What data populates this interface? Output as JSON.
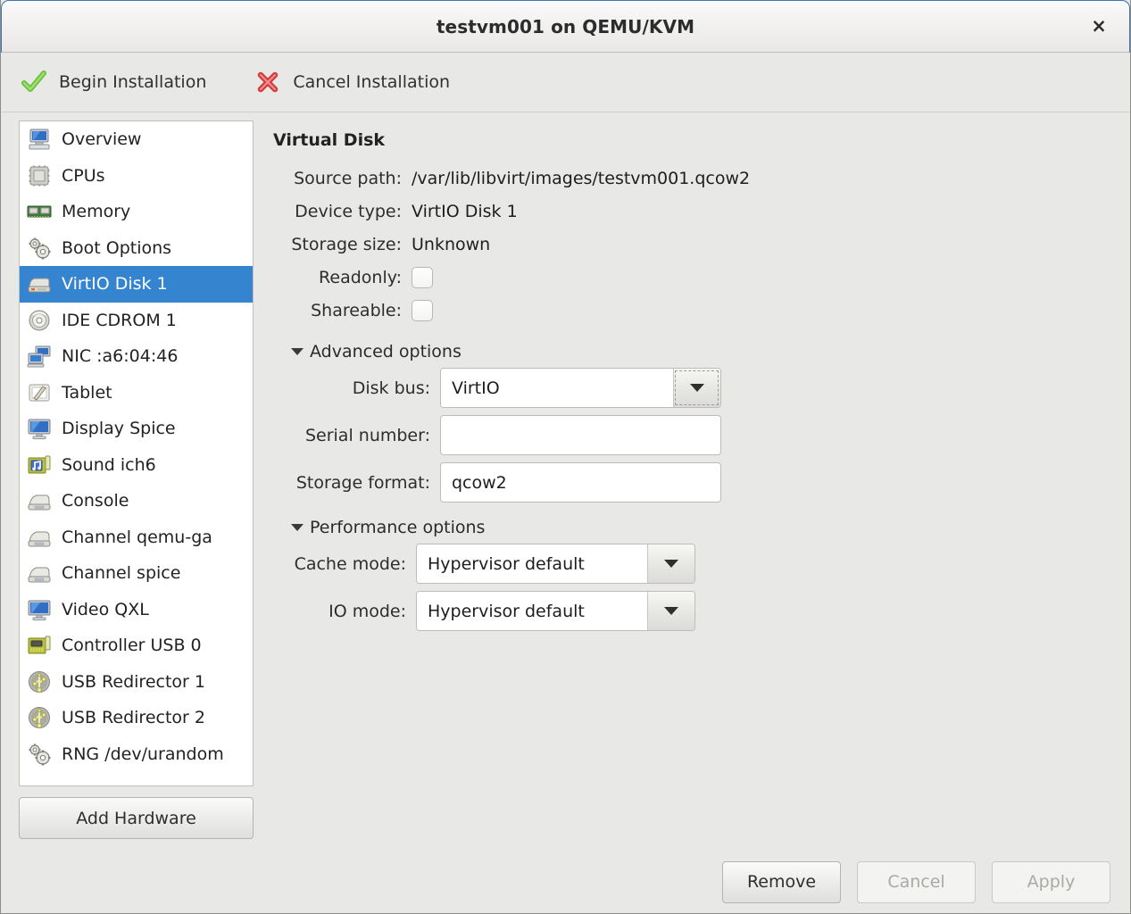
{
  "window": {
    "title": "testvm001 on QEMU/KVM",
    "close_label": "×"
  },
  "toolbar": {
    "begin_label": "Begin Installation",
    "begin_icon": "green-check-icon",
    "cancel_label": "Cancel Installation",
    "cancel_icon": "red-x-icon"
  },
  "sidebar": {
    "items": [
      {
        "label": "Overview",
        "icon": "computer-icon",
        "selected": false
      },
      {
        "label": "CPUs",
        "icon": "cpu-chip-icon",
        "selected": false
      },
      {
        "label": "Memory",
        "icon": "memory-dimm-icon",
        "selected": false
      },
      {
        "label": "Boot Options",
        "icon": "gears-icon",
        "selected": false
      },
      {
        "label": "VirtIO Disk 1",
        "icon": "harddisk-icon",
        "selected": true
      },
      {
        "label": "IDE CDROM 1",
        "icon": "cdrom-disc-icon",
        "selected": false
      },
      {
        "label": "NIC :a6:04:46",
        "icon": "network-card-icon",
        "selected": false
      },
      {
        "label": "Tablet",
        "icon": "tablet-pen-icon",
        "selected": false
      },
      {
        "label": "Display Spice",
        "icon": "monitor-icon",
        "selected": false
      },
      {
        "label": "Sound ich6",
        "icon": "sound-card-icon",
        "selected": false
      },
      {
        "label": "Console",
        "icon": "serial-console-icon",
        "selected": false
      },
      {
        "label": "Channel qemu-ga",
        "icon": "serial-console-icon",
        "selected": false
      },
      {
        "label": "Channel spice",
        "icon": "serial-console-icon",
        "selected": false
      },
      {
        "label": "Video QXL",
        "icon": "monitor-icon",
        "selected": false
      },
      {
        "label": "Controller USB 0",
        "icon": "controller-card-icon",
        "selected": false
      },
      {
        "label": "USB Redirector 1",
        "icon": "usb-icon",
        "selected": false
      },
      {
        "label": "USB Redirector 2",
        "icon": "usb-icon",
        "selected": false
      },
      {
        "label": "RNG /dev/urandom",
        "icon": "gears-icon",
        "selected": false
      }
    ],
    "add_hardware_label": "Add Hardware"
  },
  "detail": {
    "title": "Virtual Disk",
    "fields": [
      {
        "label": "Source path:",
        "value": "/var/lib/libvirt/images/testvm001.qcow2"
      },
      {
        "label": "Device type:",
        "value": "VirtIO Disk 1"
      },
      {
        "label": "Storage size:",
        "value": "Unknown"
      }
    ],
    "readonly_label": "Readonly:",
    "readonly_checked": false,
    "shareable_label": "Shareable:",
    "shareable_checked": false,
    "advanced": {
      "heading": "Advanced options",
      "disk_bus_label": "Disk bus:",
      "disk_bus_value": "VirtIO",
      "serial_label": "Serial number:",
      "serial_value": "",
      "storage_format_label": "Storage format:",
      "storage_format_value": "qcow2"
    },
    "performance": {
      "heading": "Performance options",
      "cache_mode_label": "Cache mode:",
      "cache_mode_value": "Hypervisor default",
      "io_mode_label": "IO mode:",
      "io_mode_value": "Hypervisor default"
    }
  },
  "footer": {
    "remove_label": "Remove",
    "cancel_label": "Cancel",
    "apply_label": "Apply",
    "cancel_disabled": true,
    "apply_disabled": true
  },
  "colors": {
    "selection_blue": "#3584cf",
    "window_bg": "#e8e8e6",
    "titlebar_border": "#3b74b3",
    "list_bg": "#ffffff"
  }
}
